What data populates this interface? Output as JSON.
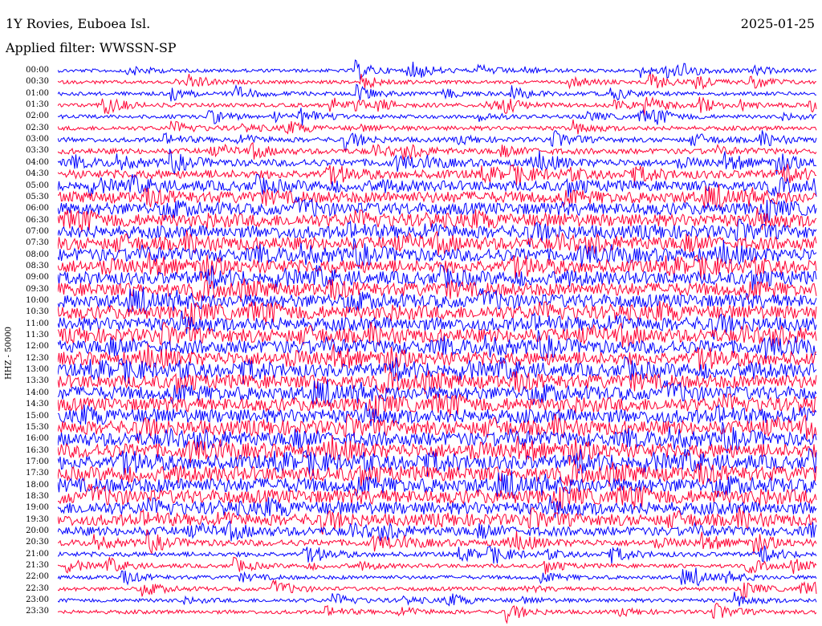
{
  "header": {
    "station": "1Y Rovies, Euboea Isl.",
    "date": "2025-01-25",
    "filter": "Applied filter: WWSSN-SP"
  },
  "channel": "HHZ - 50000",
  "colors": {
    "even_trace": "#0000ff",
    "odd_trace": "#ff0033",
    "background": "#ffffff",
    "text": "#000000"
  },
  "time_labels": [
    "00:00",
    "00:30",
    "01:00",
    "01:30",
    "02:00",
    "02:30",
    "03:00",
    "03:30",
    "04:00",
    "04:30",
    "05:00",
    "05:30",
    "06:00",
    "06:30",
    "07:00",
    "07:30",
    "08:00",
    "08:30",
    "09:00",
    "09:30",
    "10:00",
    "10:30",
    "11:00",
    "11:30",
    "12:00",
    "12:30",
    "13:00",
    "13:30",
    "14:00",
    "14:30",
    "15:00",
    "15:30",
    "16:00",
    "16:30",
    "17:00",
    "17:30",
    "18:00",
    "18:30",
    "19:00",
    "19:30",
    "20:00",
    "20:30",
    "21:00",
    "21:30",
    "22:00",
    "22:30",
    "23:00",
    "23:30"
  ],
  "trace_noise_level": [
    0.8,
    0.8,
    0.9,
    0.9,
    0.9,
    1.0,
    1.1,
    1.3,
    1.7,
    2.0,
    2.4,
    2.7,
    2.9,
    3.0,
    3.0,
    3.0,
    3.1,
    3.1,
    3.1,
    3.1,
    3.2,
    3.2,
    3.2,
    3.2,
    3.2,
    3.2,
    3.2,
    3.2,
    3.2,
    3.2,
    3.3,
    3.3,
    3.3,
    3.4,
    3.4,
    3.4,
    3.4,
    3.3,
    3.0,
    2.7,
    2.1,
    1.5,
    1.1,
    0.9,
    0.9,
    0.9,
    0.9,
    0.9
  ]
}
